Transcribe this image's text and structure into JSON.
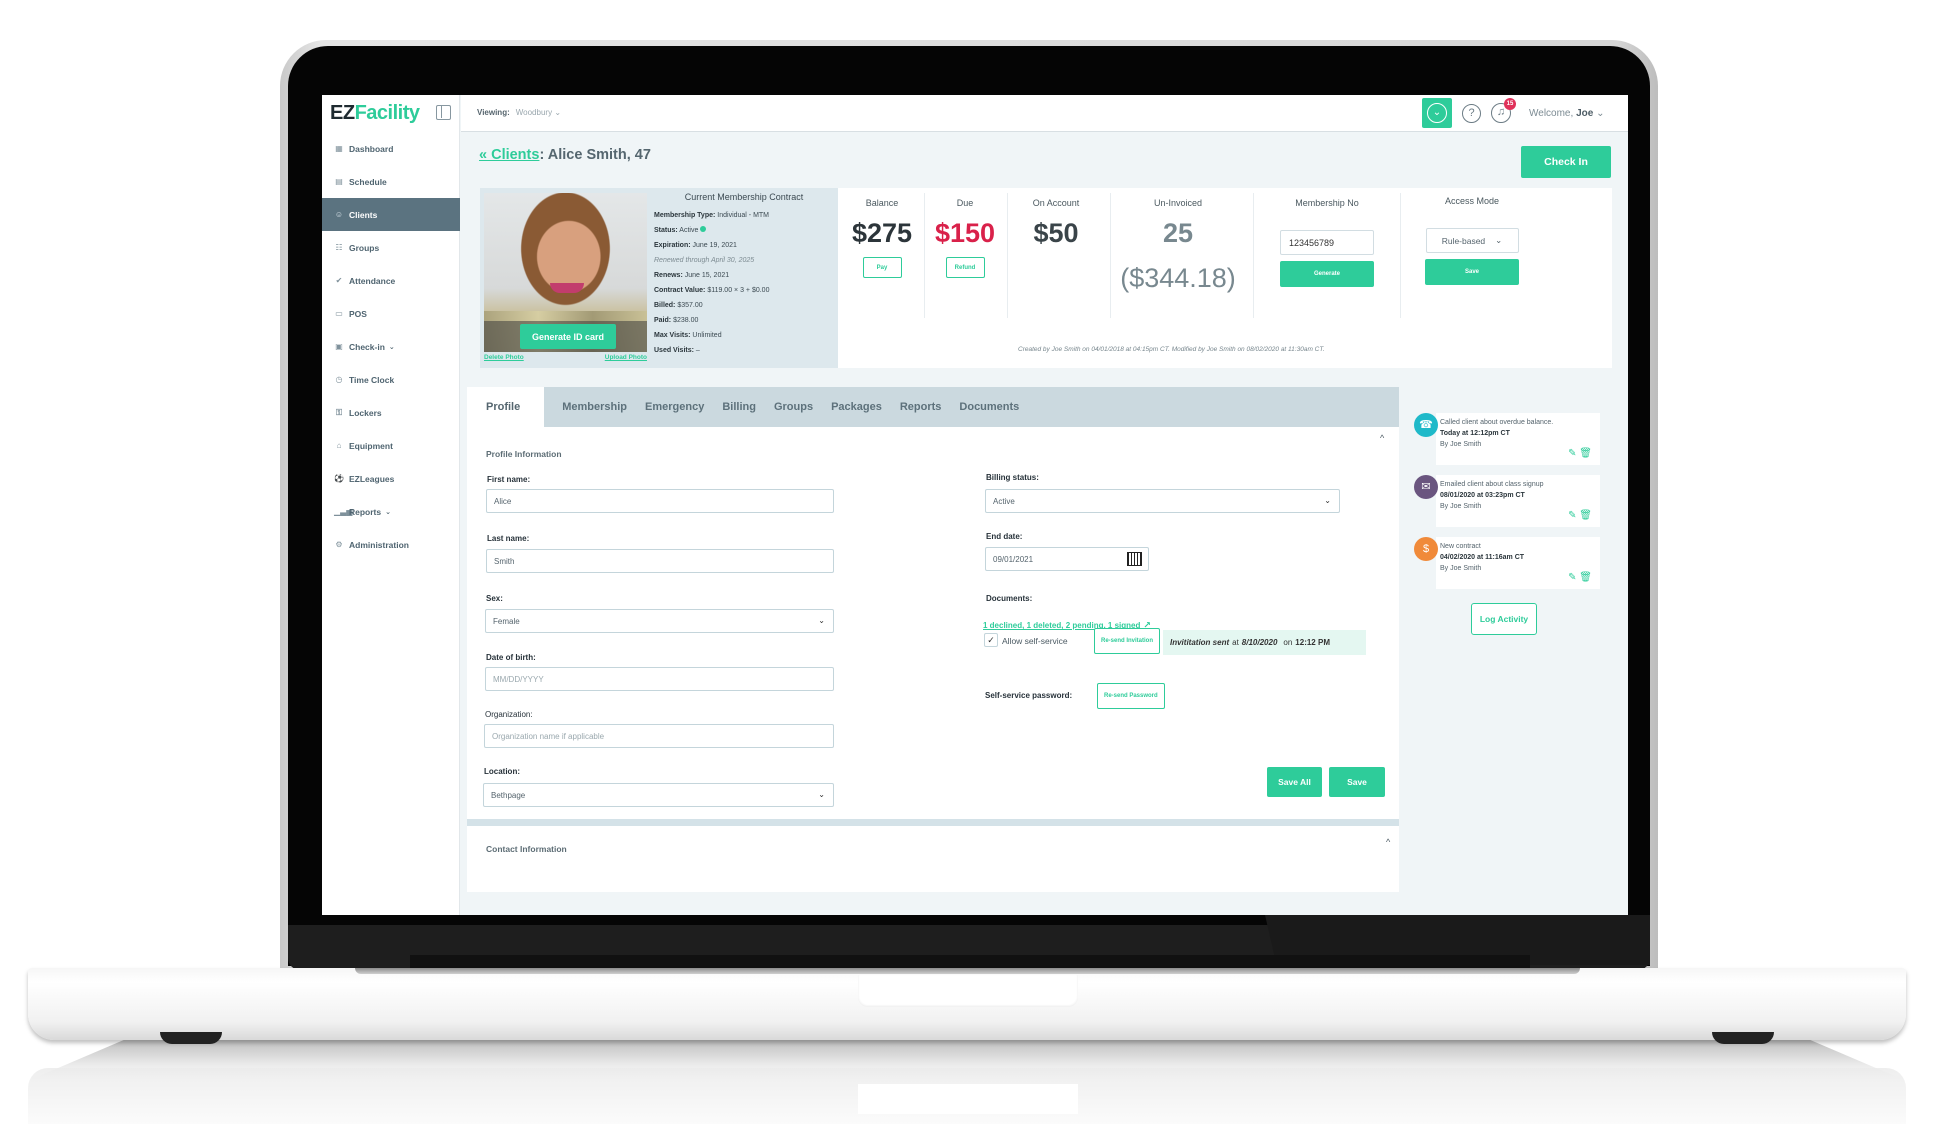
{
  "app": {
    "logo_ez": "EZ",
    "logo_facility": "Facility"
  },
  "topbar": {
    "viewing_label": "Viewing:",
    "viewing_value": "Woodbury",
    "notification_count": "15",
    "welcome_prefix": "Welcome,",
    "welcome_user": "Joe"
  },
  "sidebar": {
    "items": [
      {
        "label": "Dashboard",
        "icon": "dashboard-icon",
        "glyph": "▦"
      },
      {
        "label": "Schedule",
        "icon": "calendar-icon",
        "glyph": "▤"
      },
      {
        "label": "Clients",
        "icon": "clients-icon",
        "glyph": "☺",
        "active": true
      },
      {
        "label": "Groups",
        "icon": "groups-icon",
        "glyph": "☷"
      },
      {
        "label": "Attendance",
        "icon": "check-icon",
        "glyph": "✔"
      },
      {
        "label": "POS",
        "icon": "pos-icon",
        "glyph": "▭"
      },
      {
        "label": "Check-in",
        "icon": "checkin-icon",
        "glyph": "▣",
        "caret": "⌄"
      },
      {
        "label": "Time Clock",
        "icon": "clock-icon",
        "glyph": "◷"
      },
      {
        "label": "Lockers",
        "icon": "lock-icon",
        "glyph": "⚿"
      },
      {
        "label": "Equipment",
        "icon": "tag-icon",
        "glyph": "⌂"
      },
      {
        "label": "EZLeagues",
        "icon": "ball-icon",
        "glyph": "⚽"
      },
      {
        "label": "Reports",
        "icon": "chart-icon",
        "glyph": "▁▃▅",
        "caret": "⌄"
      },
      {
        "label": "Administration",
        "icon": "gear-icon",
        "glyph": "⚙"
      }
    ]
  },
  "header": {
    "breadcrumb_link": "« Clients",
    "client_title": ": Alice Smith, 47",
    "check_in_label": "Check In"
  },
  "contract": {
    "title": "Current Membership Contract",
    "generate_id_label": "Generate ID card",
    "delete_photo": "Delete Photo",
    "upload_photo": "Upload Photo",
    "lines": [
      {
        "label": "Membership Type:",
        "value": "Individual - MTM"
      },
      {
        "label": "Status:",
        "value": "Active"
      },
      {
        "label": "Expiration:",
        "value": "June 19, 2021"
      },
      {
        "label": "",
        "value": "Renewed through April 30, 2025",
        "italic": true
      },
      {
        "label": "Renews:",
        "value": "June 15, 2021"
      },
      {
        "label": "Contract Value:",
        "value": "$119.00 × 3 + $0.00"
      },
      {
        "label": "Billed:",
        "value": "$357.00"
      },
      {
        "label": "Paid:",
        "value": "$238.00"
      },
      {
        "label": "Max Visits:",
        "value": "Unlimited"
      },
      {
        "label": "Used Visits:",
        "value": "–"
      }
    ]
  },
  "stats": {
    "balance": {
      "label": "Balance",
      "value": "$275",
      "button": "Pay"
    },
    "due": {
      "label": "Due",
      "value": "$150",
      "button": "Refund"
    },
    "on_account": {
      "label": "On Account",
      "value": "$50"
    },
    "uninvoiced": {
      "label": "Un-Invoiced",
      "value": "25",
      "amount": "($344.18)"
    },
    "membership_no": {
      "label": "Membership No",
      "value": "123456789",
      "button": "Generate"
    },
    "access_mode": {
      "label": "Access Mode",
      "value": "Rule-based",
      "button": "Save"
    },
    "created_note": "Created by Joe Smith on 04/01/2018 at 04:15pm CT. Modified by Joe Smith on 08/02/2020 at 11:30am CT."
  },
  "tabs": [
    {
      "label": "Profile",
      "active": true
    },
    {
      "label": "Membership"
    },
    {
      "label": "Emergency"
    },
    {
      "label": "Billing"
    },
    {
      "label": "Groups"
    },
    {
      "label": "Packages"
    },
    {
      "label": "Reports"
    },
    {
      "label": "Documents"
    }
  ],
  "profile": {
    "section_title": "Profile Information",
    "first_name": {
      "label": "First name:",
      "value": "Alice"
    },
    "last_name": {
      "label": "Last name:",
      "value": "Smith"
    },
    "sex": {
      "label": "Sex:",
      "value": "Female"
    },
    "dob": {
      "label": "Date of birth:",
      "placeholder": "MM/DD/YYYY"
    },
    "organization": {
      "label": "Organization:",
      "placeholder": "Organization name if applicable"
    },
    "location": {
      "label": "Location:",
      "value": "Bethpage"
    },
    "billing_status": {
      "label": "Billing status:",
      "value": "Active"
    },
    "end_date": {
      "label": "End date:",
      "value": "09/01/2021"
    },
    "documents": {
      "label": "Documents:",
      "link": "1 declined, 1 deleted, 2 pending, 1 signed"
    },
    "self_service": {
      "checkbox_label": "Allow self-service",
      "checked": true,
      "resend_invitation": "Re-send Invitation",
      "invite_sent": "Invititation sent",
      "invite_at": "at",
      "invite_date": "8/10/2020",
      "invite_on": "on",
      "invite_time": "12:12 PM"
    },
    "password": {
      "label": "Self-service password:",
      "button": "Re-send Password"
    },
    "save_all_label": "Save All",
    "save_label": "Save"
  },
  "contact": {
    "section_title": "Contact Information"
  },
  "activity": {
    "items": [
      {
        "title": "Called client about overdue balance.",
        "time": "Today at 12:12pm CT",
        "by": "By Joe Smith",
        "icon": "phone-icon",
        "color": "#1fb9c9",
        "glyph": "☎"
      },
      {
        "title": "Emailed client about class signup",
        "time": "08/01/2020 at 03:23pm CT",
        "by": "By Joe Smith",
        "icon": "email-icon",
        "color": "#6a557f",
        "glyph": "✉"
      },
      {
        "title": "New contract",
        "time": "04/02/2020 at 11:16am CT",
        "by": "By Joe Smith",
        "icon": "contract-icon",
        "color": "#f08a3a",
        "glyph": "$"
      }
    ],
    "log_button": "Log Activity"
  },
  "colors": {
    "accent": "#2ecc9a",
    "due": "#d9214a",
    "sidebar_active": "#5b7380",
    "badge": "#e0325a"
  }
}
